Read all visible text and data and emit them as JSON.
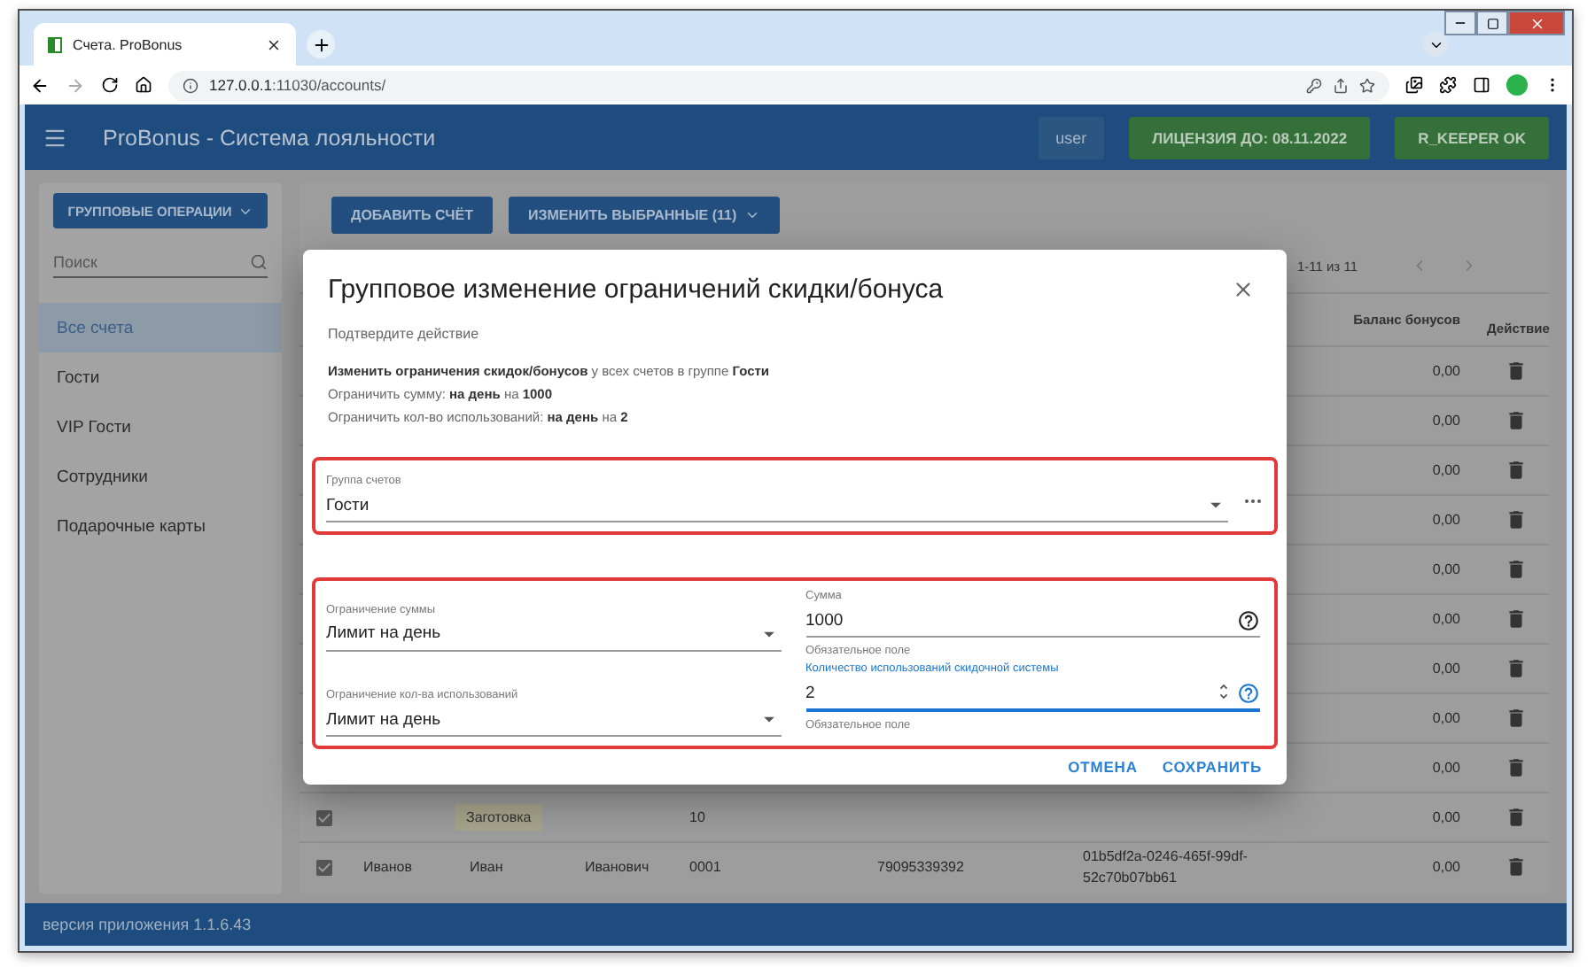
{
  "browser": {
    "tab_title": "Счета. ProBonus",
    "url_host": "127.0.0.1",
    "url_path": ":11030/accounts/"
  },
  "app_bar": {
    "title": "ProBonus - Система лояльности",
    "user": "user",
    "license": "ЛИЦЕНЗИЯ ДО: 08.11.2022",
    "status": "R_KEEPER OK"
  },
  "sidebar": {
    "group_button": "ГРУППОВЫЕ ОПЕРАЦИИ",
    "search_placeholder": "Поиск",
    "items": [
      {
        "label": "Все счета",
        "selected": true
      },
      {
        "label": "Гости",
        "selected": false
      },
      {
        "label": "VIP Гости",
        "selected": false
      },
      {
        "label": "Сотрудники",
        "selected": false
      },
      {
        "label": "Подарочные карты",
        "selected": false
      }
    ]
  },
  "toolbar": {
    "add_button": "ДОБАВИТЬ СЧЁТ",
    "edit_button": "ИЗМЕНИТЬ ВЫБРАННЫЕ (11)"
  },
  "pagination": {
    "range": "1-11 из 11"
  },
  "table": {
    "columns": [
      "Баланс бонусов",
      "Действие"
    ],
    "rows": [
      {
        "balance": "0,00"
      },
      {
        "balance": "0,00"
      },
      {
        "balance": "0,00"
      },
      {
        "balance": "0,00"
      },
      {
        "balance": "0,00"
      },
      {
        "balance": "0,00"
      },
      {
        "balance": "0,00"
      },
      {
        "balance": "0,00"
      },
      {
        "balance": "0,00"
      },
      {
        "checked": true,
        "tag": "Заготовка",
        "code": "10",
        "balance": "0,00"
      },
      {
        "checked": true,
        "last_name": "Иванов",
        "first_name": "Иван",
        "middle_name": "Иванович",
        "code": "0001",
        "phone": "79095339392",
        "card": "01b5df2a-0246-465f-99df-52c70b07bb61",
        "balance": "0,00"
      }
    ]
  },
  "dialog": {
    "title": "Групповое изменение ограничений скидки/бонуса",
    "subtitle": "Подтвердите действие",
    "summary": [
      "**Изменить ограничения скидок/бонусов** у всех счетов в группе **Гости**",
      "Ограничить сумму: **на день** на **1000**",
      "Ограничить кол-во использований: **на день** на **2**"
    ],
    "group_field": {
      "label": "Группа счетов",
      "value": "Гости"
    },
    "sum_limit": {
      "label": "Ограничение суммы",
      "value": "Лимит на день"
    },
    "sum_field": {
      "label": "Сумма",
      "value": "1000",
      "helper": "Обязательное поле",
      "focused": false
    },
    "count_limit": {
      "label": "Ограничение кол-ва использований",
      "value": "Лимит на день"
    },
    "count_field": {
      "label": "Количество использований скидочной системы",
      "value": "2",
      "helper": "Обязательное поле",
      "focused": true
    },
    "buttons": [
      "ОТМЕНА",
      "СОХРАНИТЬ"
    ]
  },
  "footer": "версия приложения 1.1.6.43"
}
